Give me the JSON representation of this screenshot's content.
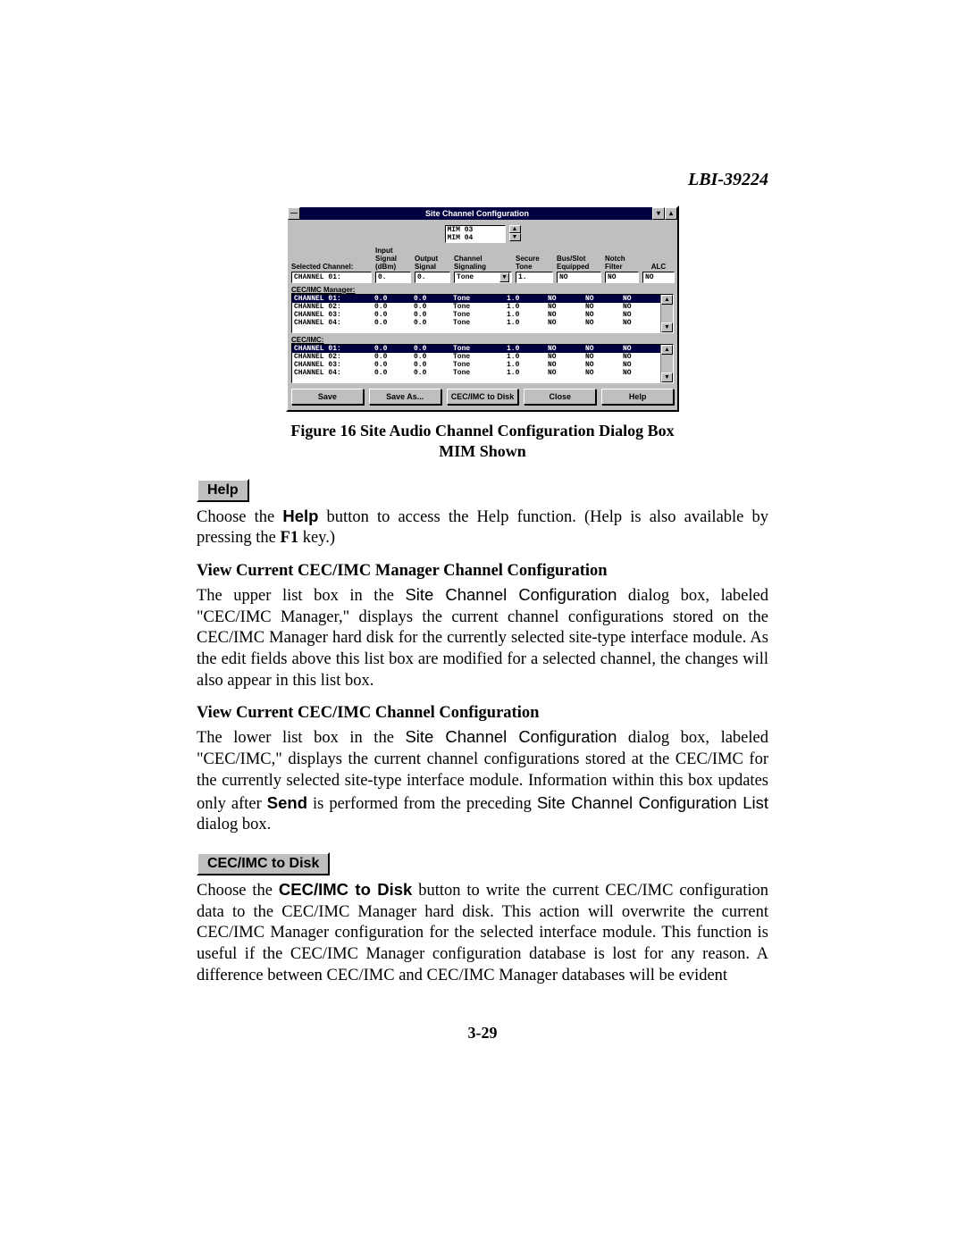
{
  "doc_id": "LBI-39224",
  "dialog": {
    "title": "Site Channel Configuration",
    "mim_list": {
      "line1": "MIM 03",
      "line2": "MIM 04"
    },
    "headers": {
      "selected": "Selected Channel:",
      "input": "Input\nSignal\n(dBm)",
      "output": "Output\nSignal",
      "signaling": "Channel\nSignaling",
      "secure": "Secure\nTone",
      "busslot": "Bus/Slot\nEquipped",
      "notch": "Notch\nFilter",
      "alc": "ALC"
    },
    "edit": {
      "channel": "CHANNEL 01:",
      "input": "0.",
      "output": "0.",
      "signaling": "Tone",
      "secure": "1.",
      "busslot": "NO",
      "notch": "NO",
      "alc": "NO"
    },
    "mgr_label": "CEC/IMC Manager:",
    "mgr_rows": [
      {
        "ch": "CHANNEL 01:",
        "in": "0.0",
        "out": "0.0",
        "sig": "Tone",
        "sec": "1.0",
        "bus": "NO",
        "notch": "NO",
        "alc": "NO",
        "sel": true
      },
      {
        "ch": "CHANNEL 02:",
        "in": "0.0",
        "out": "0.0",
        "sig": "Tone",
        "sec": "1.0",
        "bus": "NO",
        "notch": "NO",
        "alc": "NO",
        "sel": false
      },
      {
        "ch": "CHANNEL 03:",
        "in": "0.0",
        "out": "0.0",
        "sig": "Tone",
        "sec": "1.0",
        "bus": "NO",
        "notch": "NO",
        "alc": "NO",
        "sel": false
      },
      {
        "ch": "CHANNEL 04:",
        "in": "0.0",
        "out": "0.0",
        "sig": "Tone",
        "sec": "1.0",
        "bus": "NO",
        "notch": "NO",
        "alc": "NO",
        "sel": false
      }
    ],
    "cec_label": "CEC/IMC:",
    "cec_rows": [
      {
        "ch": "CHANNEL 01:",
        "in": "0.0",
        "out": "0.0",
        "sig": "Tone",
        "sec": "1.0",
        "bus": "NO",
        "notch": "NO",
        "alc": "NO",
        "sel": true
      },
      {
        "ch": "CHANNEL 02:",
        "in": "0.0",
        "out": "0.0",
        "sig": "Tone",
        "sec": "1.0",
        "bus": "NO",
        "notch": "NO",
        "alc": "NO",
        "sel": false
      },
      {
        "ch": "CHANNEL 03:",
        "in": "0.0",
        "out": "0.0",
        "sig": "Tone",
        "sec": "1.0",
        "bus": "NO",
        "notch": "NO",
        "alc": "NO",
        "sel": false
      },
      {
        "ch": "CHANNEL 04:",
        "in": "0.0",
        "out": "0.0",
        "sig": "Tone",
        "sec": "1.0",
        "bus": "NO",
        "notch": "NO",
        "alc": "NO",
        "sel": false
      }
    ],
    "buttons": {
      "save": "Save",
      "save_as": "Save As...",
      "cec_to_disk": "CEC/IMC to Disk",
      "close": "Close",
      "help": "Help"
    }
  },
  "caption_l1": "Figure 16  Site Audio Channel Configuration Dialog Box",
  "caption_l2": "MIM Shown",
  "help_pill": "Help",
  "help_para_a": "Choose the ",
  "help_para_b": "Help",
  "help_para_c": " button to access the Help function. (Help is also available by pressing the ",
  "help_para_d": "F1",
  "help_para_e": " key.)",
  "sub1": "View Current CEC/IMC Manager Channel Configuration",
  "p1a": "The upper list box in the ",
  "p1b": "Site Channel Configuration",
  "p1c": " dialog box, labeled \"CEC/IMC Manager,\" displays the current channel configurations stored on the CEC/IMC Manager hard disk for the currently selected site-type interface module.  As the edit fields above this list box are modified for a selected channel, the changes will also appear in this list box.",
  "sub2": "View Current CEC/IMC Channel Configuration",
  "p2a": "The lower list box in the ",
  "p2b": "Site Channel Configuration",
  "p2c": " dialog box, labeled \"CEC/IMC,\" displays the current channel configurations stored at the CEC/IMC for the currently selected site-type interface module. Information within this box updates only after ",
  "p2d": "Send",
  "p2e": " is performed from the preceding ",
  "p2f": "Site Channel Configuration List",
  "p2g": " dialog box.",
  "cec_pill": "CEC/IMC to Disk",
  "p3a": "Choose the ",
  "p3b": "CEC/IMC to Disk",
  "p3c": " button to write the current CEC/IMC configuration data to the CEC/IMC Manager hard disk.  This action will overwrite the current CEC/IMC Manager configuration for the selected interface module.  This function is useful if the CEC/IMC Manager configuration database is lost for any reason.  A difference between CEC/IMC and CEC/IMC Manager databases will be evident",
  "page_num": "3-29"
}
